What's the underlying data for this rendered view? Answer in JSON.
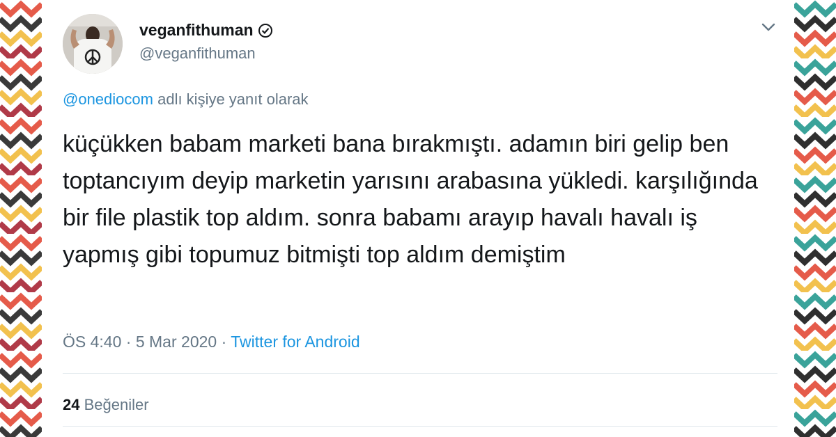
{
  "tweet": {
    "display_name": "veganfithuman",
    "handle": "@veganfithuman",
    "reply_prefix": "@onediocom",
    "reply_suffix": "adlı kişiye yanıt olarak",
    "text": "küçükken babam marketi bana bırakmıştı. adamın biri gelip ben toptancıyım deyip marketin yarısını arabasına yükledi. karşılığında bir file plastik top aldım. sonra babamı arayıp havalı havalı iş yapmış gibi topumuz bitmişti top aldım demiştim",
    "time": "ÖS 4:40",
    "date": "5 Mar 2020",
    "separator": "·",
    "source": "Twitter for Android",
    "likes_count": "24",
    "likes_label": "Beğeniler"
  },
  "colors": {
    "text": "#14171a",
    "secondary": "#657786",
    "link": "#1b95e0",
    "divider": "#e1e8ed"
  },
  "icons": {
    "verified": "verified-icon",
    "chevron": "chevron-down-icon",
    "avatar_symbol": "peace-sign-icon"
  }
}
